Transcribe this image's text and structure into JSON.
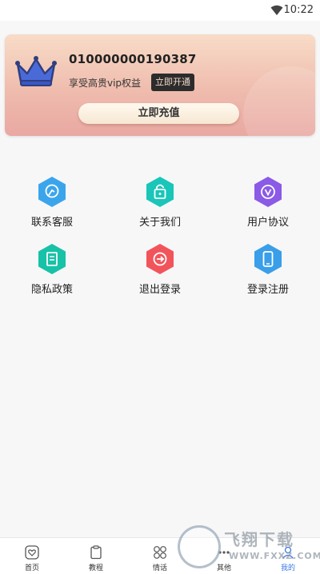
{
  "status_bar": {
    "time": "10:22",
    "wifi_icon": "wifi-icon"
  },
  "vip_card": {
    "account_id": "010000000190387",
    "vip_text": "享受高贵vip权益",
    "open_label": "立即开通",
    "recharge_label": "立即充值",
    "crown_icon": "crown-icon"
  },
  "menu": [
    {
      "label": "联系客服",
      "icon": "headset-icon",
      "color": "#3ba5ec"
    },
    {
      "label": "关于我们",
      "icon": "lock-icon",
      "color": "#19c6b9"
    },
    {
      "label": "用户协议",
      "icon": "badge-v-icon",
      "color": "#8b5ae6"
    },
    {
      "label": "隐私政策",
      "icon": "document-icon",
      "color": "#17c2a8"
    },
    {
      "label": "退出登录",
      "icon": "logout-icon",
      "color": "#f2545b"
    },
    {
      "label": "登录注册",
      "icon": "phone-icon",
      "color": "#3a9ee8"
    }
  ],
  "tabbar": {
    "items": [
      {
        "label": "首页",
        "icon": "heart-icon"
      },
      {
        "label": "教程",
        "icon": "clipboard-icon"
      },
      {
        "label": "情话",
        "icon": "grid-icon"
      },
      {
        "label": "其他",
        "icon": "more-icon"
      },
      {
        "label": "我的",
        "icon": "user-icon",
        "active": true
      }
    ],
    "active_color": "#3a78e8"
  },
  "watermark": {
    "title": "飞翔下载",
    "url": "WWW.FXXZ.COM"
  }
}
